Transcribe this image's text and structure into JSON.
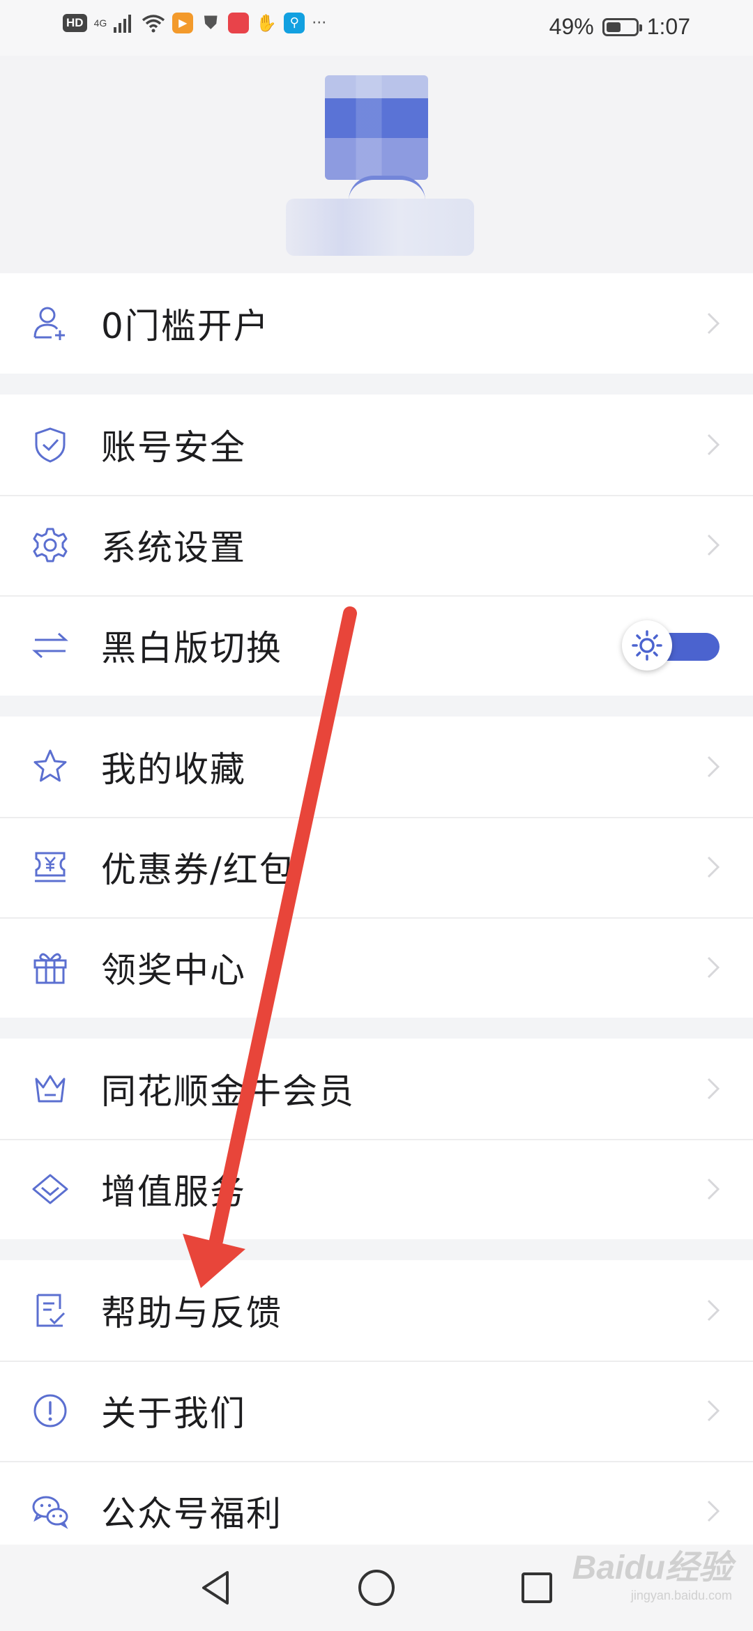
{
  "status_bar": {
    "hd": "HD",
    "network": "4G",
    "battery_percent": "49%",
    "time": "1:07",
    "more": "···",
    "battery_level": 0.49
  },
  "profile": {},
  "menu": {
    "group1": [
      {
        "label": "0门槛开户",
        "icon": "user-add-icon"
      }
    ],
    "group2": [
      {
        "label": "账号安全",
        "icon": "shield-check-icon"
      },
      {
        "label": "系统设置",
        "icon": "gear-icon"
      },
      {
        "label": "黑白版切换",
        "icon": "swap-arrows-icon",
        "toggle_on": true
      }
    ],
    "group3": [
      {
        "label": "我的收藏",
        "icon": "star-icon"
      },
      {
        "label": "优惠券/红包",
        "icon": "coupon-icon"
      },
      {
        "label": "领奖中心",
        "icon": "gift-icon"
      }
    ],
    "group4": [
      {
        "label": "同花顺金牛会员",
        "icon": "crown-icon"
      },
      {
        "label": "增值服务",
        "icon": "diamond-icon"
      }
    ],
    "group5": [
      {
        "label": "帮助与反馈",
        "icon": "feedback-icon"
      },
      {
        "label": "关于我们",
        "icon": "info-icon"
      },
      {
        "label": "公众号福利",
        "icon": "wechat-icon"
      }
    ]
  },
  "nav": {
    "back_icon": "back-triangle-icon",
    "home_icon": "home-circle-icon",
    "recents_icon": "recents-square-icon"
  },
  "watermark": {
    "main": "Baidu经验",
    "sub": "jingyan.baidu.com"
  },
  "colors": {
    "accent": "#4b63cf",
    "icon": "#5b6fd0",
    "arrow": "#e8453a"
  }
}
